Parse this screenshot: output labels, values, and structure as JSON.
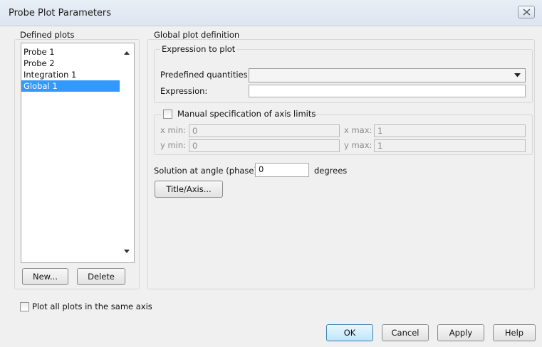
{
  "window": {
    "title": "Probe Plot Parameters"
  },
  "defined_plots": {
    "label": "Defined plots",
    "items": [
      {
        "label": "Probe 1",
        "selected": false
      },
      {
        "label": "Probe 2",
        "selected": false
      },
      {
        "label": "Integration 1",
        "selected": false
      },
      {
        "label": "Global 1",
        "selected": true
      }
    ],
    "new_label": "New...",
    "delete_label": "Delete"
  },
  "definition": {
    "label": "Global plot definition",
    "expression_group": {
      "label": "Expression to plot",
      "predefined_label": "Predefined quantities:",
      "predefined_value": "",
      "expression_label": "Expression:",
      "expression_value": ""
    },
    "axis_limits": {
      "label": "Manual specification of axis limits",
      "checked": false,
      "xmin_label": "x min:",
      "xmin_value": "0",
      "xmax_label": "x max:",
      "xmax_value": "1",
      "ymin_label": "y min:",
      "ymin_value": "0",
      "ymax_label": "y max:",
      "ymax_value": "1"
    },
    "solution_angle_label": "Solution at angle (phase):",
    "solution_angle_value": "0",
    "solution_angle_unit": "degrees",
    "title_axis_label": "Title/Axis..."
  },
  "plot_same_axis": {
    "label": "Plot all plots in the same axis",
    "checked": false
  },
  "footer": {
    "ok": "OK",
    "cancel": "Cancel",
    "apply": "Apply",
    "help": "Help"
  },
  "colors": {
    "selection": "#3399ff",
    "ok_border": "#3c7fb1"
  }
}
